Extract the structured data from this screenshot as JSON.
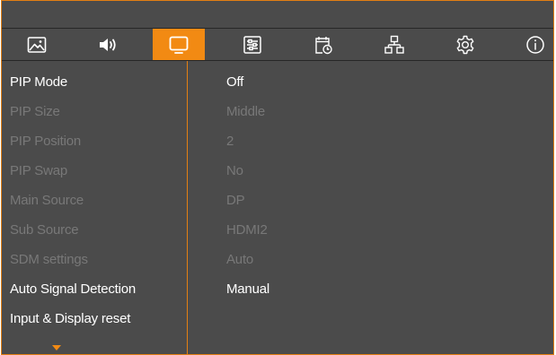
{
  "tabs": [
    {
      "id": "picture",
      "icon": "picture-icon"
    },
    {
      "id": "sound",
      "icon": "speaker-icon"
    },
    {
      "id": "screen",
      "icon": "monitor-icon",
      "active": true
    },
    {
      "id": "adjust",
      "icon": "sliders-icon"
    },
    {
      "id": "schedule",
      "icon": "calendar-clock-icon"
    },
    {
      "id": "network",
      "icon": "network-icon"
    },
    {
      "id": "settings",
      "icon": "gear-icon"
    },
    {
      "id": "info",
      "icon": "info-icon"
    }
  ],
  "menu": [
    {
      "label": "PIP Mode",
      "value": "Off",
      "enabled": true
    },
    {
      "label": "PIP Size",
      "value": "Middle",
      "enabled": false
    },
    {
      "label": "PIP Position",
      "value": "2",
      "enabled": false
    },
    {
      "label": "PIP Swap",
      "value": "No",
      "enabled": false
    },
    {
      "label": "Main Source",
      "value": "DP",
      "enabled": false
    },
    {
      "label": "Sub Source",
      "value": "HDMI2",
      "enabled": false
    },
    {
      "label": "SDM settings",
      "value": "Auto",
      "enabled": false
    },
    {
      "label": "Auto Signal Detection",
      "value": "Manual",
      "enabled": true
    },
    {
      "label": "Input & Display reset",
      "value": "",
      "enabled": true
    }
  ],
  "colors": {
    "accent": "#f28a13",
    "background": "#4b4b4b",
    "text_enabled": "#ffffff",
    "text_disabled": "#787878"
  },
  "scroll_indicator": "scroll-down-arrow-icon"
}
